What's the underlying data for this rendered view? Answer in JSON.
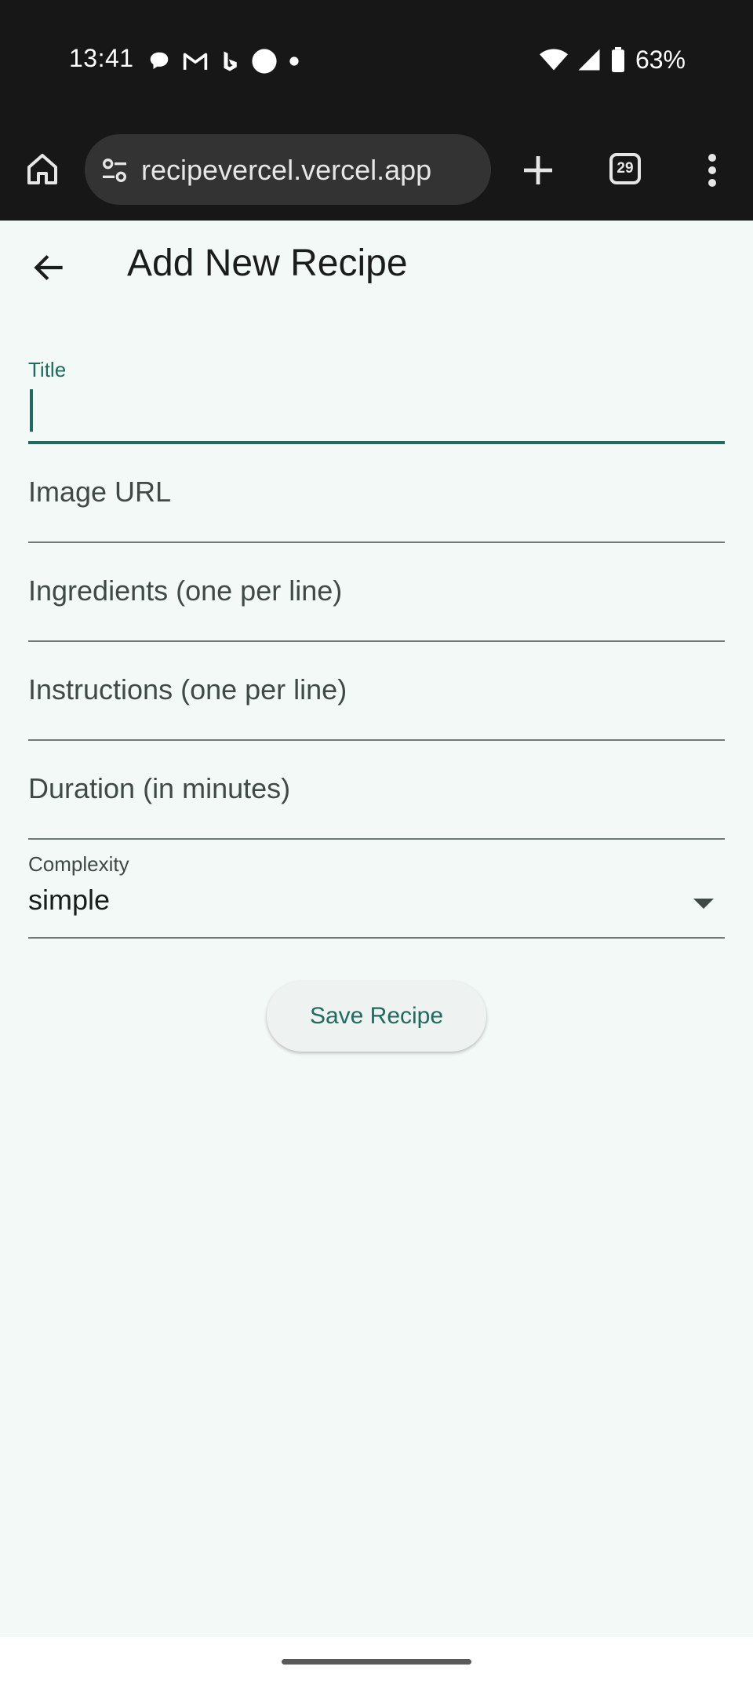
{
  "status_bar": {
    "time": "13:41",
    "notification_icons": [
      "chat-bubble-icon",
      "gmail-icon",
      "bing-icon",
      "circle-icon",
      "dot-icon"
    ],
    "system_icons": [
      "wifi-icon",
      "cellular-signal-icon",
      "battery-icon"
    ],
    "battery_percent": "63%"
  },
  "browser": {
    "url": "recipevercel.vercel.app",
    "tab_count": "29",
    "icons": [
      "home-icon",
      "site-settings-icon",
      "plus-icon",
      "tab-switcher-icon",
      "more-vert-icon"
    ]
  },
  "app_bar": {
    "title": "Add New Recipe",
    "back_icon": "arrow-back-icon"
  },
  "form": {
    "title_label": "Title",
    "title_value": "",
    "image_url_placeholder": "Image URL",
    "ingredients_placeholder": "Ingredients (one per line)",
    "instructions_placeholder": "Instructions (one per line)",
    "duration_placeholder": "Duration (in minutes)",
    "complexity_label": "Complexity",
    "complexity_value": "simple",
    "save_label": "Save Recipe"
  },
  "colors": {
    "accent": "#1f6b5e",
    "background": "#f3f9f7",
    "system_bar": "#171717"
  }
}
